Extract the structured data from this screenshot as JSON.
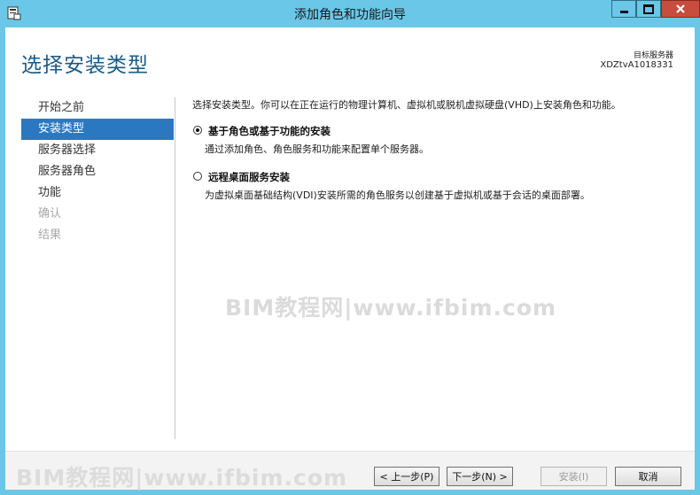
{
  "window": {
    "title": "添加角色和功能向导",
    "minimize_glyph": "▁",
    "maximize_glyph": "□",
    "close_glyph": "✕"
  },
  "header": {
    "page_title": "选择安装类型",
    "destination_label": "目标服务器",
    "destination_value": "XDZtvA1018331"
  },
  "nav": {
    "items": [
      {
        "label": "开始之前",
        "state": "normal"
      },
      {
        "label": "安装类型",
        "state": "selected"
      },
      {
        "label": "服务器选择",
        "state": "normal"
      },
      {
        "label": "服务器角色",
        "state": "normal"
      },
      {
        "label": "功能",
        "state": "normal"
      },
      {
        "label": "确认",
        "state": "disabled"
      },
      {
        "label": "结果",
        "state": "disabled"
      }
    ]
  },
  "main": {
    "description": "选择安装类型。你可以在正在运行的物理计算机、虚拟机或脱机虚拟硬盘(VHD)上安装角色和功能。",
    "options": [
      {
        "title": "基于角色或基于功能的安装",
        "description": "通过添加角色、角色服务和功能来配置单个服务器。",
        "checked": true
      },
      {
        "title": "远程桌面服务安装",
        "description": "为虚拟桌面基础结构(VDI)安装所需的角色服务以创建基于虚拟机或基于会话的桌面部署。",
        "checked": false
      }
    ]
  },
  "footer": {
    "previous_label": "< 上一步(P)",
    "next_label": "下一步(N) >",
    "install_label": "安装(I)",
    "cancel_label": "取消"
  },
  "watermark": {
    "text": "BIM教程网|www.ifbim.com"
  },
  "colors": {
    "title_bar": "#6ac7e8",
    "selected_nav": "#2b78c0",
    "page_title": "#1a5a86",
    "close_button": "#c74d3f"
  }
}
